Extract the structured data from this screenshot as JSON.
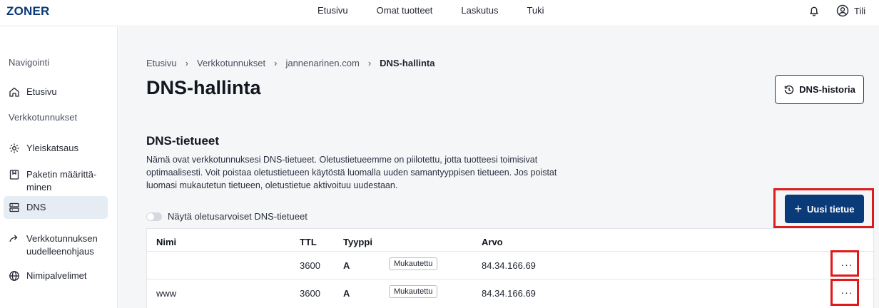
{
  "brand": {
    "logo_text": "ZONER",
    "logo_color": "#0b3a78"
  },
  "topnav": {
    "items": [
      "Etusivu",
      "Omat tuotteet",
      "Laskutus",
      "Tuki"
    ]
  },
  "account": {
    "label": "Tili",
    "icons": [
      "bell-icon",
      "user-circle-icon"
    ]
  },
  "sidebar": {
    "heading_nav": "Navigointi",
    "item_home": "Etusivu",
    "heading_domains": "Verkkotunnukset",
    "item_overview": "Yleiskatsaus",
    "item_package_line1": "Paketin määrittä-",
    "item_package_line2": "minen",
    "item_dns": "DNS",
    "item_redirect_line1": "Verkkotunnuksen",
    "item_redirect_line2": "uudelleenohjaus",
    "item_nameservers": "Nimipalvelimet",
    "active_item": "DNS"
  },
  "breadcrumb": [
    "Etusivu",
    "Verkkotunnukset",
    "jannenarinen.com",
    "DNS-hallinta"
  ],
  "page": {
    "title": "DNS-hallinta",
    "history_button": "DNS-historia",
    "section_title": "DNS-tietueet",
    "section_desc": "Nämä ovat verkkotunnuksesi DNS-tietueet. Oletustietueemme on piilotettu, jotta tuotteesi toimisivat optimaalisesti. Voit poistaa oletustietueen käytöstä luomalla uuden samantyyppisen tietueen. Jos poistat luomasi mukautetun tietueen, oletustietue aktivoituu uudestaan.",
    "new_button": "Uusi tietue",
    "toggle_label": "Näytä oletusarvoiset DNS-tietueet",
    "toggle_on": false
  },
  "table": {
    "headers": {
      "name": "Nimi",
      "ttl": "TTL",
      "type": "Tyyppi",
      "value": "Arvo"
    },
    "rows": [
      {
        "name": "",
        "ttl": "3600",
        "type": "A",
        "badge": "Mukautettu",
        "value": "84.34.166.69",
        "menu": "···"
      },
      {
        "name": "www",
        "ttl": "3600",
        "type": "A",
        "badge": "Mukautettu",
        "value": "84.34.166.69",
        "menu": "···"
      }
    ]
  },
  "colors": {
    "accent": "#0b3a78",
    "highlight": "#e11919",
    "background": "#f5f6f8"
  }
}
